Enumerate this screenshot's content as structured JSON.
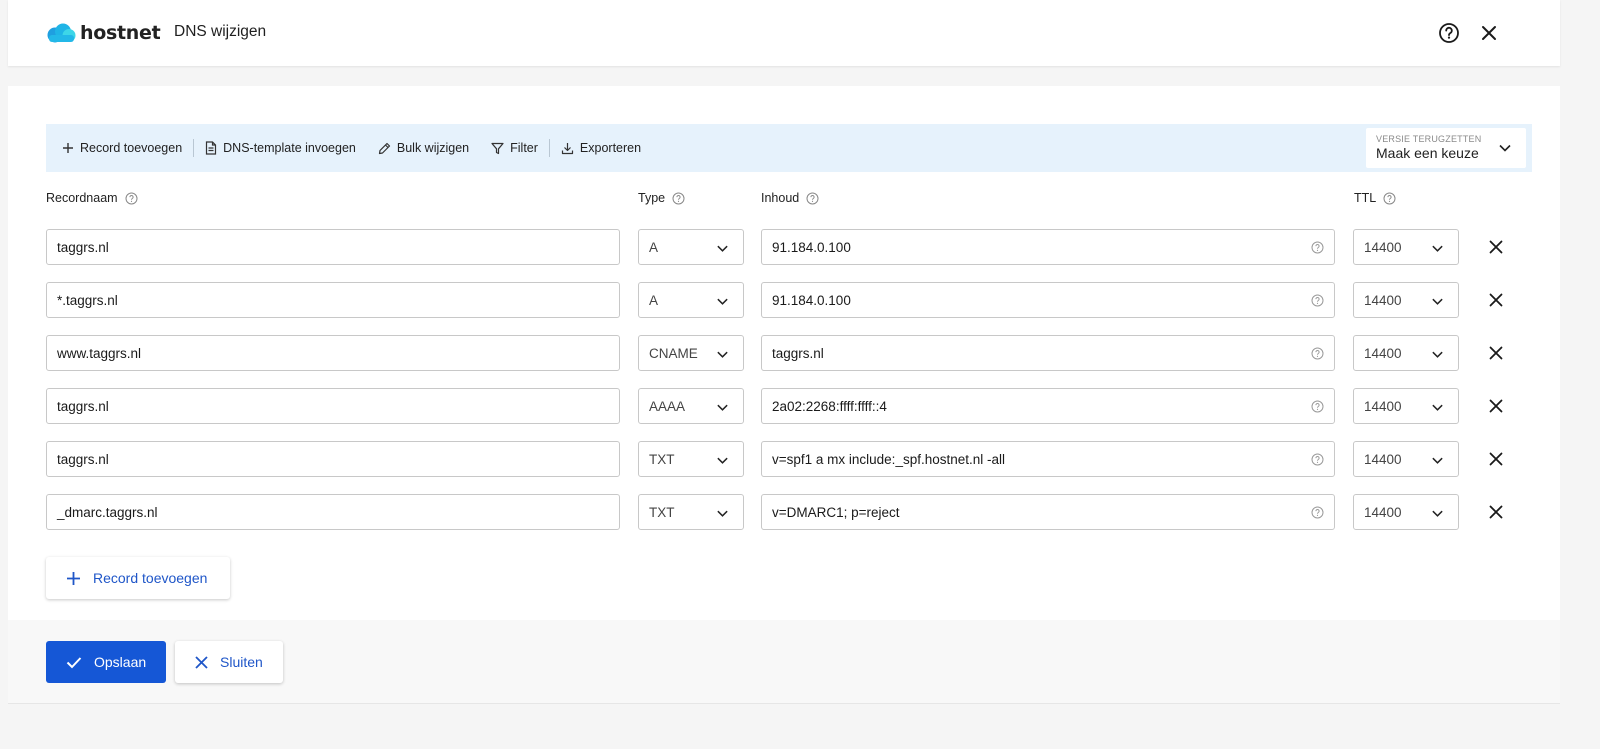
{
  "header": {
    "logo_text": "hostnet",
    "title": "DNS wijzigen"
  },
  "toolbar": {
    "add_record": "Record toevoegen",
    "dns_template": "DNS-template invoegen",
    "bulk_edit": "Bulk wijzigen",
    "filter": "Filter",
    "export": "Exporteren",
    "version_label": "Versie terugzetten",
    "version_value": "Maak een keuze"
  },
  "columns": {
    "name": "Recordnaam",
    "type": "Type",
    "content": "Inhoud",
    "ttl": "TTL"
  },
  "records": [
    {
      "name": "taggrs.nl",
      "type": "A",
      "content": "91.184.0.100",
      "ttl": "14400"
    },
    {
      "name": "*.taggrs.nl",
      "type": "A",
      "content": "91.184.0.100",
      "ttl": "14400"
    },
    {
      "name": "www.taggrs.nl",
      "type": "CNAME",
      "content": "taggrs.nl",
      "ttl": "14400"
    },
    {
      "name": "taggrs.nl",
      "type": "AAAA",
      "content": "2a02:2268:ffff:ffff::4",
      "ttl": "14400"
    },
    {
      "name": "taggrs.nl",
      "type": "TXT",
      "content": "v=spf1 a mx include:_spf.hostnet.nl -all",
      "ttl": "14400"
    },
    {
      "name": "_dmarc.taggrs.nl",
      "type": "TXT",
      "content": "v=DMARC1; p=reject",
      "ttl": "14400"
    }
  ],
  "add_record_button": "Record toevoegen",
  "footer": {
    "save": "Opslaan",
    "close": "Sluiten"
  },
  "colors": {
    "primary": "#1557d6",
    "toolbar_bg": "#e6f2fc",
    "logo_cloud_dark": "#1f9fe0",
    "logo_cloud_light": "#3dd6e8"
  },
  "icons": {
    "help": "help-circle-icon",
    "close": "close-icon",
    "plus": "plus-icon",
    "document": "document-icon",
    "pencil": "pencil-icon",
    "filter": "filter-icon",
    "download": "download-icon",
    "chevron": "chevron-down-icon",
    "check": "check-icon"
  }
}
